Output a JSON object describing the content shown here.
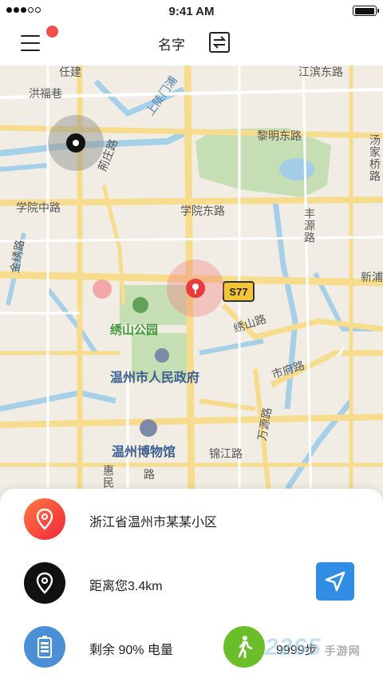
{
  "status_bar": {
    "time": "9:41 AM",
    "carrier": ""
  },
  "navbar": {
    "title": "名字"
  },
  "map": {
    "labels": {
      "hongfuxiang": "洪福巷",
      "zhuijian": "任建",
      "shangxiemen": "上陡门浦",
      "jiangbin": "江滨东路",
      "limingdong": "黎明东路",
      "qianzhuang": "荊庄路",
      "xueyuanzhong": "学院中路",
      "xueyuandong": "学院东路",
      "jinxiu": "金绣路",
      "fengyuan": "丰源路",
      "tangjiaqiao": "汤家桥路",
      "xinpu": "新浦",
      "xiushanpark": "绣山公园",
      "xiushanroad": "绣山路",
      "government": "温州市人民政府",
      "shifu": "市府路",
      "wanyuan": "万源路",
      "museum": "温州博物馆",
      "jinjiang": "锦江路",
      "road_s77": "S77",
      "huihong": "惠民",
      "lu": "路"
    }
  },
  "sheet": {
    "address": "浙江省温州市某某小区",
    "distance": "距离您3.4km",
    "battery_text": "剩余 90% 电量",
    "steps": "9999步",
    "watermark": "2265",
    "watermark_sub": "手游网"
  },
  "icons": {
    "menu": "hamburger-menu-icon",
    "swap": "swap-icon",
    "address": "location-pin-icon",
    "distance": "location-pin-icon",
    "navigate": "navigation-arrow-icon",
    "battery": "battery-icon",
    "steps": "walking-person-icon"
  },
  "colors": {
    "accent_red": "#f0504a",
    "pin_red": "#ea3b3b",
    "navigate_blue": "#2f8de4",
    "battery_blue": "#4b8fd6",
    "steps_green": "#6abe2a"
  },
  "battery_level": 0.9
}
